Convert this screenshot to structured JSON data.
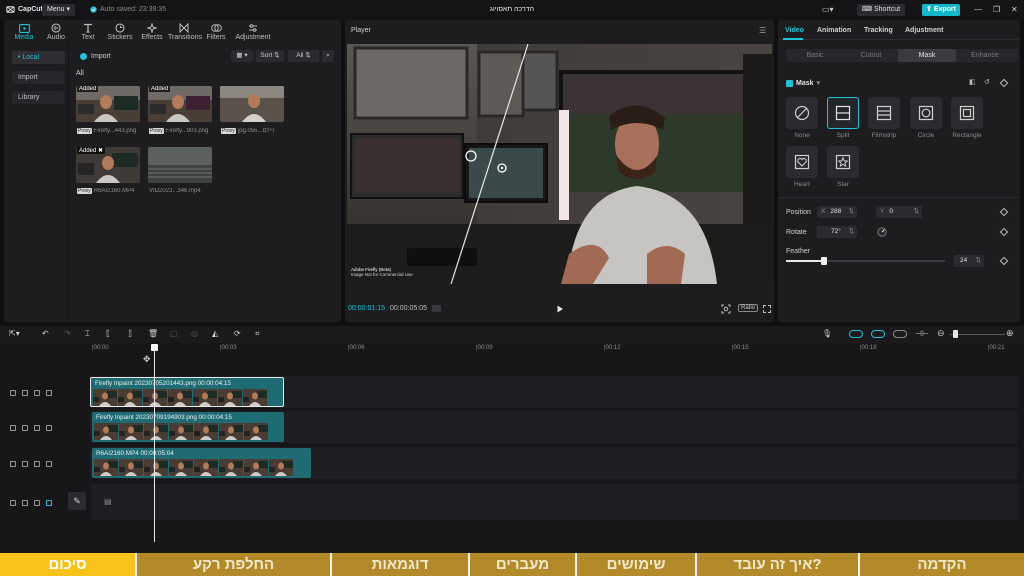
{
  "topbar": {
    "logo": "CapCut",
    "menu_label": "Menu",
    "autosave": "Auto saved: 23:39:35",
    "doc_title": "הדרכה תאסויוג",
    "shortcut_label": "Shortcut",
    "export_label": "Export"
  },
  "media_tools": [
    {
      "label": "Media",
      "icon": "media-icon"
    },
    {
      "label": "Audio",
      "icon": "audio-icon"
    },
    {
      "label": "Text",
      "icon": "text-icon"
    },
    {
      "label": "Stickers",
      "icon": "stickers-icon"
    },
    {
      "label": "Effects",
      "icon": "effects-icon"
    },
    {
      "label": "Transitions",
      "icon": "transitions-icon"
    },
    {
      "label": "Filters",
      "icon": "filters-icon"
    },
    {
      "label": "Adjustment",
      "icon": "adjustment-icon"
    }
  ],
  "media_side": {
    "local": "• Local",
    "import": "Import",
    "library": "Library"
  },
  "media_controls": {
    "import_label": "Import",
    "sort_label": "Sort",
    "all_filter": "All",
    "all_label": "All"
  },
  "media_items": [
    {
      "badge": "Added",
      "proxy": "Proxy",
      "name": "Firefly...443.png"
    },
    {
      "badge": "Added",
      "proxy": "Proxy",
      "name": "Firefly...903.png"
    },
    {
      "badge": "",
      "proxy": "Proxy",
      "name": "jpg.055...ויילם"
    },
    {
      "badge": "Added ✖",
      "proxy": "Proxy",
      "name": "R6AI2160.MP4"
    },
    {
      "badge": "",
      "proxy": "",
      "name": "VID2023...346.mp4"
    }
  ],
  "player": {
    "title": "Player",
    "timecode_current": "00:00:01:15",
    "timecode_total": "00:00:05:05",
    "ratio_label": "Ratio",
    "watermark_line1": "Adobe Firefly (Beta)",
    "watermark_line2": "Image Not for Commercial Use"
  },
  "inspector": {
    "tabs": [
      "Video",
      "Animation",
      "Tracking",
      "Adjustment"
    ],
    "sub_tabs": [
      "Basic",
      "Cutout",
      "Mask",
      "Enhance"
    ],
    "mask_title": "Mask",
    "mask_options": [
      "None",
      "Split",
      "Filmstrip",
      "Circle",
      "Rectangle",
      "Heart",
      "Star"
    ],
    "position_label": "Position",
    "position_x": "288",
    "position_y": "0",
    "axis_x": "X",
    "axis_y": "Y",
    "rotate_label": "Rotate",
    "rotate_value": "72°",
    "feather_label": "Feather",
    "feather_value": "24",
    "feather_fraction": 0.24
  },
  "ruler": [
    "00:00",
    "00:03",
    "00:06",
    "00:09",
    "00:12",
    "00:15",
    "00:18",
    "00:21"
  ],
  "tracks": [
    {
      "clip_title": "Firefly Inpaint 20230705201443.png   00:00:04:15"
    },
    {
      "clip_title": "Firefly Inpaint 20230709194903.png   00:00:04:15"
    },
    {
      "clip_title": "R6AI2160.MP4    00:00:05:04"
    }
  ],
  "chapters": [
    "סיכום",
    "החלפת רקע",
    "דוגמאות",
    "מעברים",
    "שימושים",
    "איך זה עובד?",
    "הקדמה"
  ],
  "colors": {
    "accent": "#22c3d6",
    "export": "#12b7c9",
    "chapter_bar": "#b38a2a",
    "chapter_active": "#f7c31a",
    "clip": "#1e6b73"
  }
}
